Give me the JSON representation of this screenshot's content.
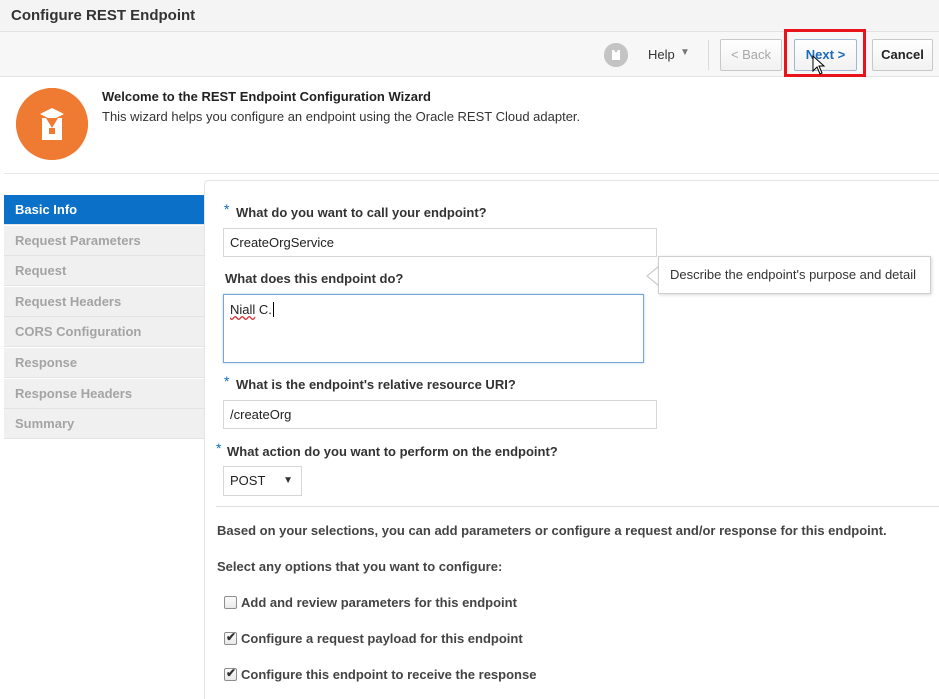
{
  "window": {
    "title": "Configure REST Endpoint"
  },
  "toolbar": {
    "help_label": "Help",
    "back_label": "< Back",
    "next_label": "Next  >",
    "cancel_label": "Cancel"
  },
  "welcome": {
    "title": "Welcome to the REST Endpoint Configuration Wizard",
    "subtitle": "This wizard helps you configure an endpoint using the Oracle REST Cloud adapter."
  },
  "sidebar": {
    "items": [
      {
        "label": "Basic Info",
        "active": true
      },
      {
        "label": "Request Parameters",
        "active": false
      },
      {
        "label": "Request",
        "active": false
      },
      {
        "label": "Request Headers",
        "active": false
      },
      {
        "label": "CORS Configuration",
        "active": false
      },
      {
        "label": "Response",
        "active": false
      },
      {
        "label": "Response Headers",
        "active": false
      },
      {
        "label": "Summary",
        "active": false
      }
    ]
  },
  "form": {
    "required_marker": "*",
    "name_label": "What do you want to call your endpoint?",
    "name_value": "CreateOrgService",
    "desc_label": "What does this endpoint do?",
    "desc_value_word1": "Niall",
    "desc_value_word2": " C.",
    "tooltip": "Describe the endpoint's purpose and detail",
    "uri_label": "What is the endpoint's relative resource URI?",
    "uri_value": "/createOrg",
    "action_label": "What action do you want to perform on the endpoint?",
    "action_value": "POST",
    "info_text": "Based on your selections, you can add parameters or configure a request and/or response for this endpoint.",
    "options_heading": "Select any options that you want to configure:",
    "options": [
      {
        "label": "Add and review parameters for this endpoint",
        "checked": false
      },
      {
        "label": "Configure a request payload for this endpoint",
        "checked": true
      },
      {
        "label": "Configure this endpoint to receive the response",
        "checked": true
      }
    ]
  },
  "colors": {
    "accent": "#0a70c8",
    "logo": "#ef7b33",
    "highlight": "#e8131b"
  }
}
